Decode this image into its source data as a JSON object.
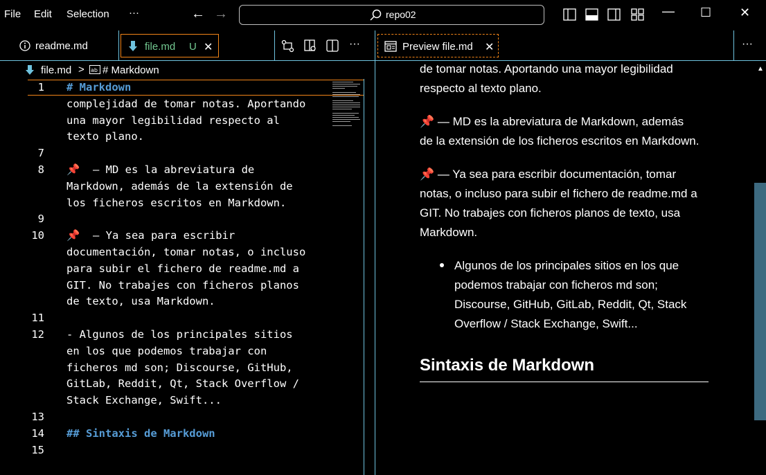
{
  "menu": {
    "file": "File",
    "edit": "Edit",
    "selection": "Selection",
    "more": "···"
  },
  "nav": {
    "back": "←",
    "forward": "→"
  },
  "search": {
    "label": "repo02"
  },
  "window": {
    "minimize": "—",
    "maximize": "☐",
    "close": "✕"
  },
  "tabs": {
    "readme": {
      "label": "readme.md",
      "icon": "info-icon"
    },
    "file": {
      "label": "file.md",
      "status": "U",
      "close": "✕",
      "icon": "markdown-icon"
    },
    "preview": {
      "label": "Preview file.md",
      "close": "✕",
      "icon": "preview-icon"
    },
    "more": "···",
    "preview_more": "···"
  },
  "breadcrumb": {
    "file": "file.md",
    "sep": ">",
    "symbol": "# Markdown"
  },
  "editor": {
    "lines": [
      {
        "num": "1",
        "text": "# Markdown",
        "heading": true
      },
      {
        "num": "",
        "text": "complejidad de tomar notas. Aportando"
      },
      {
        "num": "",
        "text": "una mayor legibilidad respecto al"
      },
      {
        "num": "",
        "text": "texto plano."
      },
      {
        "num": "7",
        "text": ""
      },
      {
        "num": "8",
        "text": "📌  — MD es la abreviatura de"
      },
      {
        "num": "",
        "text": "Markdown, además de la extensión de"
      },
      {
        "num": "",
        "text": "los ficheros escritos en Markdown."
      },
      {
        "num": "9",
        "text": ""
      },
      {
        "num": "10",
        "text": "📌  — Ya sea para escribir"
      },
      {
        "num": "",
        "text": "documentación, tomar notas, o incluso"
      },
      {
        "num": "",
        "text": "para subir el fichero de readme.md a"
      },
      {
        "num": "",
        "text": "GIT. No trabajes con ficheros planos"
      },
      {
        "num": "",
        "text": "de texto, usa Markdown."
      },
      {
        "num": "11",
        "text": ""
      },
      {
        "num": "12",
        "text": "- Algunos de los principales sitios"
      },
      {
        "num": "",
        "text": "en los que podemos trabajar con"
      },
      {
        "num": "",
        "text": "ficheros md son; Discourse, GitHub,"
      },
      {
        "num": "",
        "text": "GitLab, Reddit, Qt, Stack Overflow /"
      },
      {
        "num": "",
        "text": "Stack Exchange, Swift..."
      },
      {
        "num": "13",
        "text": ""
      },
      {
        "num": "14",
        "text": "## Sintaxis de Markdown",
        "heading": true
      },
      {
        "num": "15",
        "text": ""
      }
    ]
  },
  "preview": {
    "lines": [
      "de tomar notas. Aportando una mayor legibilidad",
      "respecto al texto plano.",
      "📌 — MD es la abreviatura de Markdown, además",
      "de la extensión de los ficheros escritos en Markdown.",
      "📌 — Ya sea para escribir documentación, tomar",
      "notas, o incluso para subir el fichero de readme.md a",
      "GIT. No trabajes con ficheros planos de texto, usa",
      "Markdown."
    ],
    "bullet": [
      "Algunos de los principales sitios en los que",
      "podemos trabajar con ficheros md son;",
      "Discourse, GitHub, GitLab, Reddit, Qt, Stack",
      "Overflow / Stack Exchange, Swift..."
    ],
    "heading": "Sintaxis de Markdown",
    "scroll_up": "▲"
  },
  "colors": {
    "accent_border": "#6fc3df",
    "active_border": "#f38518",
    "heading": "#569cd6",
    "scrollbar": "#3d6a80"
  }
}
